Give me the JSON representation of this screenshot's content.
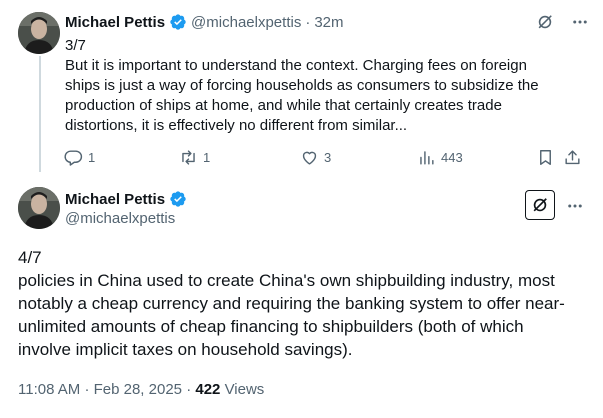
{
  "colors": {
    "text": "#0f1419",
    "muted": "#536471",
    "verified": "#1d9bf0",
    "divider": "#cfd9de"
  },
  "tweet1": {
    "author_name": "Michael Pettis",
    "handle": "@michaelxpettis",
    "separator": "·",
    "time": "32m",
    "body_lines": [
      "3/7",
      "But it is important to understand the context. Charging fees on foreign",
      "ships is just a way of forcing households as consumers to subsidize the",
      "production of ships at home, and while that certainly creates trade",
      "distortions, it is effectively no different from similar..."
    ],
    "actions": {
      "reply_count": "1",
      "retweet_count": "1",
      "like_count": "3",
      "view_count": "443"
    },
    "icons": [
      "grok-icon",
      "more-icon",
      "reply-icon",
      "retweet-icon",
      "like-icon",
      "views-icon",
      "bookmark-icon",
      "share-icon"
    ]
  },
  "tweet2": {
    "author_name": "Michael Pettis",
    "handle": "@michaelxpettis",
    "body_lines": [
      "4/7",
      "policies in China used to create China's own shipbuilding industry, most",
      "notably a cheap currency and requiring the banking system to offer near-",
      "unlimited amounts of cheap financing to shipbuilders (both of which",
      "involve implicit taxes on household savings)."
    ],
    "time": "11:08 AM",
    "meta_separator": "·",
    "date": "Feb 28, 2025",
    "views_count": "422",
    "views_label": "Views",
    "icons": [
      "grok-icon",
      "more-icon"
    ]
  }
}
